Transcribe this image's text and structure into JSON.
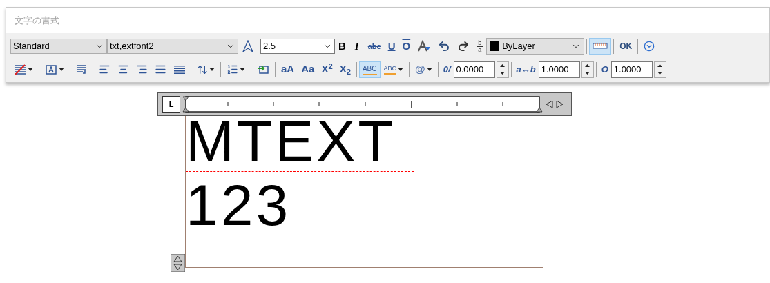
{
  "window": {
    "title": "文字の書式"
  },
  "toolbar_rows": [
    [
      {
        "kind": "style-combo",
        "value": "Standard"
      },
      {
        "kind": "font-combo",
        "value": "txt,extfont2"
      },
      {
        "kind": "annotative",
        "selected": false
      },
      {
        "kind": "input-combo",
        "value": "2.5"
      },
      {
        "kind": "bold",
        "label": "B",
        "selected": false
      },
      {
        "kind": "italic",
        "label": "I",
        "selected": false
      },
      {
        "kind": "strike",
        "label": "abc",
        "selected": false
      },
      {
        "kind": "underline",
        "label": "U",
        "selected": false
      },
      {
        "kind": "overline",
        "label": "O",
        "selected": false
      },
      {
        "kind": "text-color",
        "selected": false
      },
      {
        "kind": "undo",
        "selected": false
      },
      {
        "kind": "redo",
        "selected": false
      },
      {
        "kind": "stack",
        "top": "b",
        "bottom": "a",
        "selected": false
      },
      {
        "kind": "swatch-combo",
        "value": "ByLayer",
        "color": "#000000"
      },
      {
        "kind": "separator"
      },
      {
        "kind": "ruler",
        "selected": true
      },
      {
        "kind": "separator"
      },
      {
        "kind": "ok",
        "label": "OK",
        "selected": false
      },
      {
        "kind": "separator"
      },
      {
        "kind": "options",
        "selected": false
      }
    ],
    [
      {
        "kind": "mask",
        "selected": false
      },
      {
        "kind": "separator"
      },
      {
        "kind": "justify",
        "selected": false
      },
      {
        "kind": "separator"
      },
      {
        "kind": "paragraph",
        "selected": false
      },
      {
        "kind": "separator"
      },
      {
        "kind": "align-left",
        "selected": false
      },
      {
        "kind": "align-center",
        "selected": false
      },
      {
        "kind": "align-right",
        "selected": false
      },
      {
        "kind": "align-justify",
        "selected": false
      },
      {
        "kind": "align-distribute",
        "selected": false
      },
      {
        "kind": "separator"
      },
      {
        "kind": "line-spacing",
        "selected": false
      },
      {
        "kind": "separator"
      },
      {
        "kind": "numbering",
        "selected": false
      },
      {
        "kind": "separator"
      },
      {
        "kind": "field",
        "selected": false
      },
      {
        "kind": "separator"
      },
      {
        "kind": "case",
        "label": "aA",
        "selected": false
      },
      {
        "kind": "case",
        "label": "Aa",
        "selected": false
      },
      {
        "kind": "script",
        "label": "X$^{2}$",
        "selected": false
      },
      {
        "kind": "script",
        "label": "X$_{2}$",
        "selected": false
      },
      {
        "kind": "separator"
      },
      {
        "kind": "spell",
        "label": "ABC",
        "selected": true
      },
      {
        "kind": "dictionary",
        "label": "ABC",
        "selected": false
      },
      {
        "kind": "separator"
      },
      {
        "kind": "symbol",
        "label": "@",
        "selected": false
      },
      {
        "kind": "separator"
      },
      {
        "kind": "label",
        "label": "0/"
      },
      {
        "kind": "spinner",
        "value": "0.0000"
      },
      {
        "kind": "separator"
      },
      {
        "kind": "label",
        "label": "a↔b"
      },
      {
        "kind": "spinner",
        "value": "1.0000"
      },
      {
        "kind": "separator"
      },
      {
        "kind": "label",
        "label": "O"
      },
      {
        "kind": "spinner",
        "value": "1.0000"
      }
    ]
  ],
  "editor": {
    "tab_button": "L",
    "lines": [
      "MTEXT",
      "123"
    ]
  }
}
